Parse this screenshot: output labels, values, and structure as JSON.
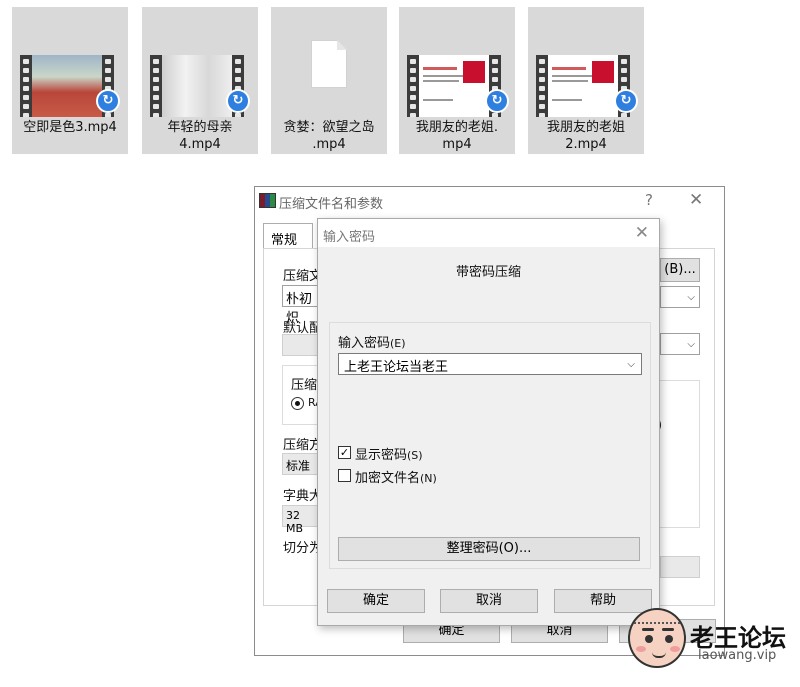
{
  "files": [
    {
      "name": "空即是色3.mp4",
      "thumb": "campus"
    },
    {
      "name": "年轻的母亲4.mp4",
      "thumb": "grey"
    },
    {
      "name": "贪婪：欲望之岛.mp4",
      "thumb": "blank-document"
    },
    {
      "name": "我朋友的老姐.mp4",
      "thumb": "ad"
    },
    {
      "name": "我朋友的老姐2.mp4",
      "thumb": "ad"
    }
  ],
  "file_labels": {
    "f0_l1": "空即是色3.mp4",
    "f1_l1": "年轻的母亲",
    "f1_l2": "4.mp4",
    "f2_l1": "贪婪：欲望之岛",
    "f2_l2": ".mp4",
    "f3_l1": "我朋友的老姐.",
    "f3_l2": "mp4",
    "f4_l1": "我朋友的老姐",
    "f4_l2": "2.mp4"
  },
  "back_dialog": {
    "title": "压缩文件名和参数",
    "help": "?",
    "close": "✕",
    "tab_general": "常规",
    "archive_label": "压缩文",
    "archive_value": "朴初炽",
    "browse_button": "(B)...",
    "default_profile_label": "默认配",
    "format_label": "压缩",
    "format_radio": "RA",
    "method_label": "压缩方",
    "method_value": "标准",
    "dict_label": "字典大",
    "dict_value": "32 MB",
    "split_label": "切分为",
    "ok": "确定",
    "cancel": "取消",
    "right_paren": ")"
  },
  "password_dialog": {
    "title": "输入密码",
    "close": "✕",
    "heading": "带密码压缩",
    "enter_password_label": "输入密码",
    "enter_password_key": "(E)",
    "password_value": "上老王论坛当老王",
    "show_password_label": "显示密码",
    "show_password_key": "(S)",
    "show_password_checked": true,
    "encrypt_names_label": "加密文件名",
    "encrypt_names_key": "(N)",
    "encrypt_names_checked": false,
    "organize_button": "整理密码(O)...",
    "ok": "确定",
    "cancel": "取消",
    "help": "帮助"
  },
  "watermark": {
    "name": "老王论坛",
    "url": "laowang.vip"
  }
}
